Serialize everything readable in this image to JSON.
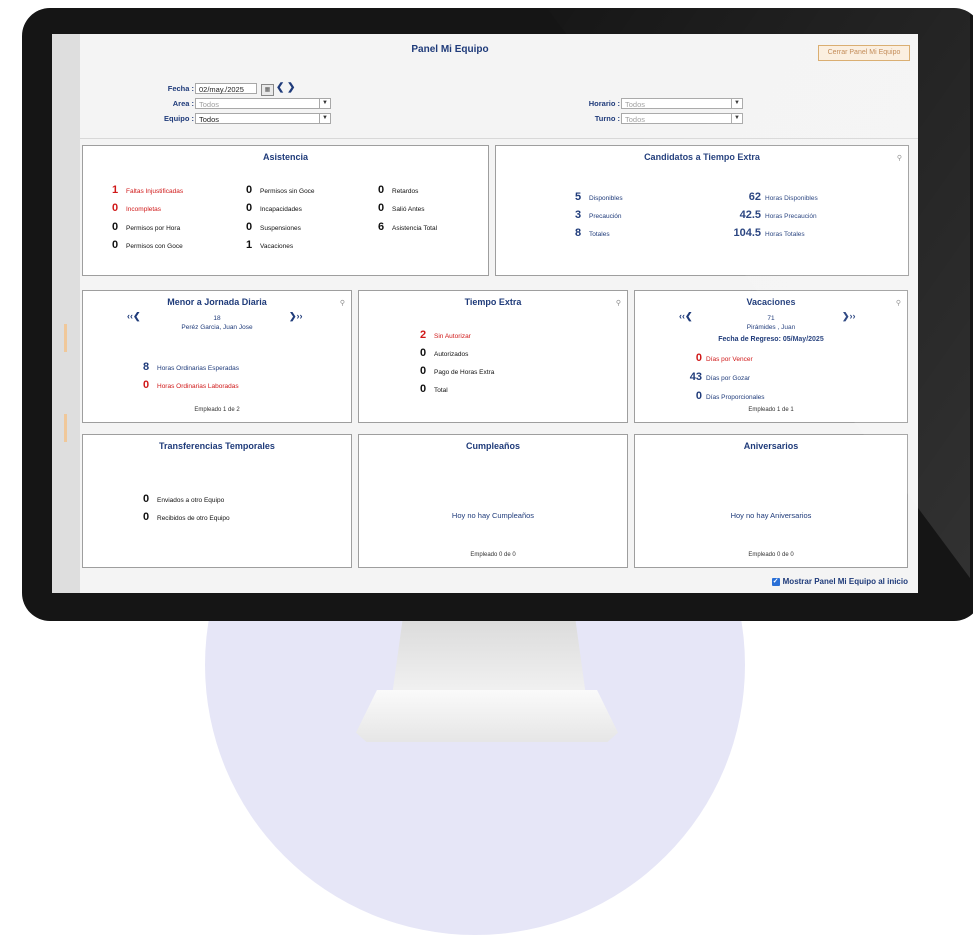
{
  "header": {
    "title": "Panel Mi Equipo",
    "close_label": "Cerrar Panel Mi Equipo"
  },
  "filters": {
    "fecha_label": "Fecha :",
    "fecha_value": "02/may./2025",
    "area_label": "Area :",
    "area_value": "Todos",
    "equipo_label": "Equipo :",
    "equipo_value": "Todos",
    "horario_label": "Horario :",
    "horario_value": "Todos",
    "turno_label": "Turno :",
    "turno_value": "Todos"
  },
  "asistencia": {
    "title": "Asistencia",
    "items": [
      {
        "n": "1",
        "t": "Faltas Injustificadas"
      },
      {
        "n": "0",
        "t": "Incompletas"
      },
      {
        "n": "0",
        "t": "Permisos por Hora"
      },
      {
        "n": "0",
        "t": "Permisos con Goce"
      },
      {
        "n": "0",
        "t": "Permisos sin Goce"
      },
      {
        "n": "0",
        "t": "Incapacidades"
      },
      {
        "n": "0",
        "t": "Suspensiones"
      },
      {
        "n": "1",
        "t": "Vacaciones"
      },
      {
        "n": "0",
        "t": "Retardos"
      },
      {
        "n": "0",
        "t": "Salió Antes"
      },
      {
        "n": "6",
        "t": "Asistencia Total"
      }
    ]
  },
  "candidatos": {
    "title": "Candidatos a Tiempo Extra",
    "items": [
      {
        "n": "5",
        "t": "Disponibles"
      },
      {
        "n": "3",
        "t": "Precaución"
      },
      {
        "n": "8",
        "t": "Totales"
      },
      {
        "n": "62",
        "t": "Horas Disponibles"
      },
      {
        "n": "42.5",
        "t": "Horas Precaución"
      },
      {
        "n": "104.5",
        "t": "Horas Totales"
      }
    ]
  },
  "menor_jornada": {
    "title": "Menor a Jornada Diaria",
    "emp_num": "18",
    "emp_name": "Peréz Garcia, Juan Jose",
    "items": [
      {
        "n": "8",
        "t": "Horas Ordinarias Esperadas"
      },
      {
        "n": "0",
        "t": "Horas Ordinarias Laboradas"
      }
    ],
    "footer": "Empleado 1 de 2"
  },
  "tiempo_extra": {
    "title": "Tiempo Extra",
    "items": [
      {
        "n": "2",
        "t": "Sin Autorizar"
      },
      {
        "n": "0",
        "t": "Autorizados"
      },
      {
        "n": "0",
        "t": "Pago de Horas Extra"
      },
      {
        "n": "0",
        "t": "Total"
      }
    ]
  },
  "vacaciones": {
    "title": "Vacaciones",
    "emp_num": "71",
    "emp_name": "Pirámides , Juan",
    "regreso": "Fecha de Regreso: 05/May/2025",
    "items": [
      {
        "n": "0",
        "t": "Días por Vencer"
      },
      {
        "n": "43",
        "t": "Días por Gozar"
      },
      {
        "n": "0",
        "t": "Días Proporcionales"
      }
    ],
    "footer": "Empleado 1 de 1"
  },
  "transferencias": {
    "title": "Transferencias Temporales",
    "items": [
      {
        "n": "0",
        "t": "Enviados a otro Equipo"
      },
      {
        "n": "0",
        "t": "Recibidos de otro Equipo"
      }
    ]
  },
  "cumpleanos": {
    "title": "Cumpleaños",
    "message": "Hoy no hay Cumpleaños",
    "footer": "Empleado 0 de 0"
  },
  "aniversarios": {
    "title": "Aniversarios",
    "message": "Hoy no hay Aniversarios",
    "footer": "Empleado 0 de 0"
  },
  "footer": {
    "show_label": "Mostrar Panel Mi Equipo al inicio"
  },
  "colors": {
    "accent": "#1f3b7a",
    "alert": "#d01818",
    "checkbox": "#2a6fd6"
  }
}
